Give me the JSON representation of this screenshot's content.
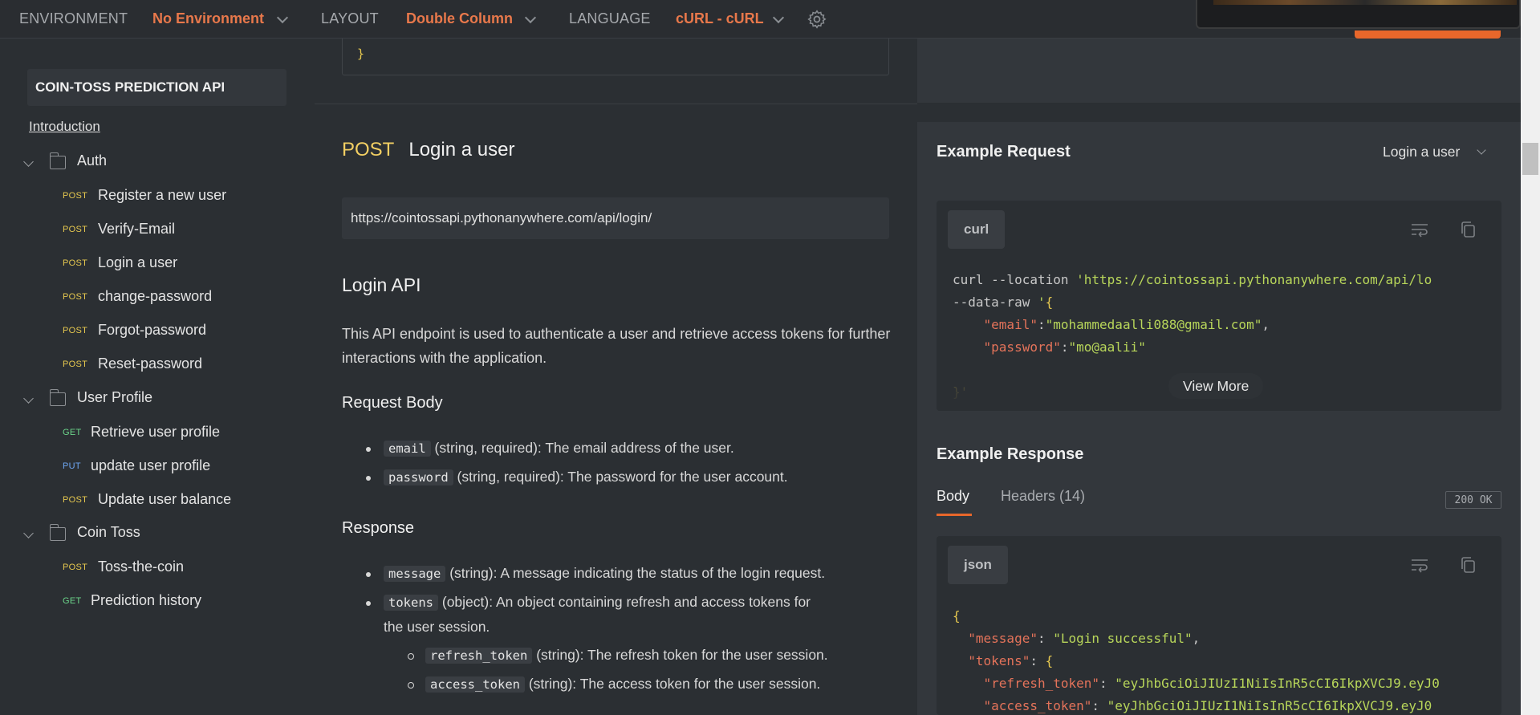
{
  "topbar": {
    "environment_label": "ENVIRONMENT",
    "environment_value": "No Environment",
    "layout_label": "LAYOUT",
    "layout_value": "Double Column",
    "language_label": "LANGUAGE",
    "language_value": "cURL - cURL"
  },
  "sidebar": {
    "api_title": "COIN-TOSS PREDICTION API",
    "introduction": "Introduction",
    "folders": [
      {
        "label": "Auth",
        "items": [
          {
            "method": "POST",
            "label": "Register a new user"
          },
          {
            "method": "POST",
            "label": "Verify-Email"
          },
          {
            "method": "POST",
            "label": "Login a user"
          },
          {
            "method": "POST",
            "label": "change-password"
          },
          {
            "method": "POST",
            "label": "Forgot-password"
          },
          {
            "method": "POST",
            "label": "Reset-password"
          }
        ]
      },
      {
        "label": "User Profile",
        "items": [
          {
            "method": "GET",
            "label": "Retrieve user profile"
          },
          {
            "method": "PUT",
            "label": "update user profile"
          },
          {
            "method": "POST",
            "label": "Update user balance"
          }
        ]
      },
      {
        "label": "Coin Toss",
        "items": [
          {
            "method": "POST",
            "label": "Toss-the-coin"
          },
          {
            "method": "GET",
            "label": "Prediction history"
          }
        ]
      }
    ]
  },
  "main": {
    "top_code_closing": "}",
    "method": "POST",
    "endpoint_title": "Login a user",
    "url": "https://cointossapi.pythonanywhere.com/api/login/",
    "section_title": "Login API",
    "description": "This API endpoint is used to authenticate a user and retrieve access tokens for further interactions with the application.",
    "request_body_title": "Request Body",
    "request_body": [
      {
        "code": "email",
        "text": " (string, required): The email address of the user."
      },
      {
        "code": "password",
        "text": " (string, required): The password for the user account."
      }
    ],
    "response_title": "Response",
    "response": [
      {
        "code": "message",
        "text": " (string): A message indicating the status of the login request."
      },
      {
        "code": "tokens",
        "text": " (object): An object containing refresh and access tokens for",
        "text2": "the user session."
      }
    ],
    "response_tokens": [
      {
        "code": "refresh_token",
        "text": " (string): The refresh token for the user session."
      },
      {
        "code": "access_token",
        "text": " (string): The access token for the user session."
      }
    ]
  },
  "example_request": {
    "title": "Example Request",
    "selected": "Login a user",
    "lang": "curl",
    "code": {
      "l1_cmd": "curl --location ",
      "l1_url": "'https://cointossapi.pythonanywhere.com/api/lo",
      "l2_flag": "--data-raw ",
      "l2_q": "'",
      "l2_brace": "{",
      "l3_key": "\"email\"",
      "l3_val": "\"mohammedaalli088@gmail.com\"",
      "l4_key": "\"password\"",
      "l4_val": "\"mo@aalii\"",
      "l5": "}'"
    },
    "view_more": "View More"
  },
  "example_response": {
    "title": "Example Response",
    "tab_body": "Body",
    "tab_headers": "Headers (14)",
    "status": "200 OK",
    "lang": "json",
    "code": {
      "l1": "{",
      "l2_key": "\"message\"",
      "l2_val": "\"Login successful\"",
      "l3_key": "\"tokens\"",
      "l3_brace": "{",
      "l4_key": "\"refresh_token\"",
      "l4_val": "\"eyJhbGciOiJIUzI1NiIsInR5cCI6IkpXVCJ9.eyJ0",
      "l5_key": "\"access_token\"",
      "l5_val": "\"eyJhbGciOiJIUzI1NiIsInR5cCI6IkpXVCJ9.eyJ0"
    }
  },
  "colors": {
    "accent": "#e8784b",
    "post": "#e6c84f",
    "get": "#6bd48a",
    "put": "#6ea6f2"
  }
}
